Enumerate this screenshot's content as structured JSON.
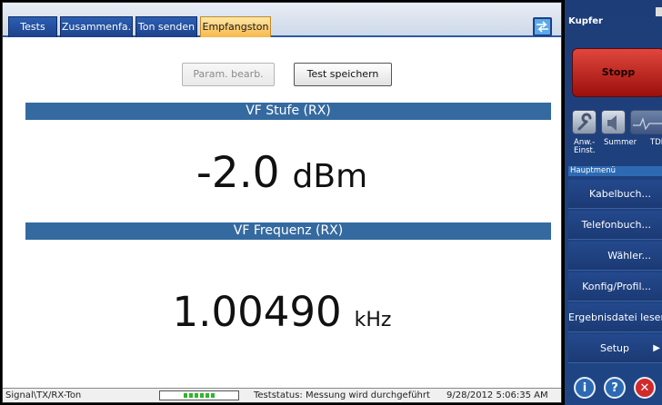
{
  "tabs": [
    {
      "label": "Tests"
    },
    {
      "label": "Zusammenfa."
    },
    {
      "label": "Ton senden"
    },
    {
      "label": "Empfangston"
    }
  ],
  "active_tab": "Empfangston",
  "buttons": {
    "edit_params": "Param. bearb.",
    "save_test": "Test speichern"
  },
  "measurements": {
    "level_title": "VF Stufe (RX)",
    "level_value": "-2.0",
    "level_unit": "dBm",
    "freq_title": "VF Frequenz (RX)",
    "freq_value": "1.00490",
    "freq_unit": "kHz"
  },
  "status": {
    "path": "Signal\\TX/RX-Ton",
    "progress_fraction": 0.4,
    "text": "Teststatus: Messung wird durchgeführt",
    "timestamp": "9/28/2012 5:06:35 AM"
  },
  "side": {
    "title": "Kupfer",
    "stop_label": "Stopp",
    "quick_labels": {
      "app": "Anw.-\nEinst.",
      "summary": "Summer",
      "tdr": "TDR"
    },
    "menu_header": "Hauptmenü",
    "menu_items": [
      {
        "label": "Kabelbuch..."
      },
      {
        "label": "Telefonbuch..."
      },
      {
        "label": "Wähler..."
      },
      {
        "label": "Konfig/Profil..."
      },
      {
        "label": "Ergebnisdatei lesen"
      },
      {
        "label": "Setup"
      }
    ]
  },
  "colors": {
    "section_bar": "#356aa0",
    "tab_active": "#f6b94a",
    "tab_inactive": "#1d418a",
    "stop": "#c0221c",
    "side_bg": "#1f4585"
  },
  "icons": {
    "swap": "swap-icon",
    "wrench": "wrench-icon",
    "speaker": "speaker-icon",
    "tdr": "tdr-wave-icon",
    "info": "info-icon",
    "help": "help-icon",
    "close": "close-icon",
    "menu_arrow": "triangle-right-icon"
  }
}
